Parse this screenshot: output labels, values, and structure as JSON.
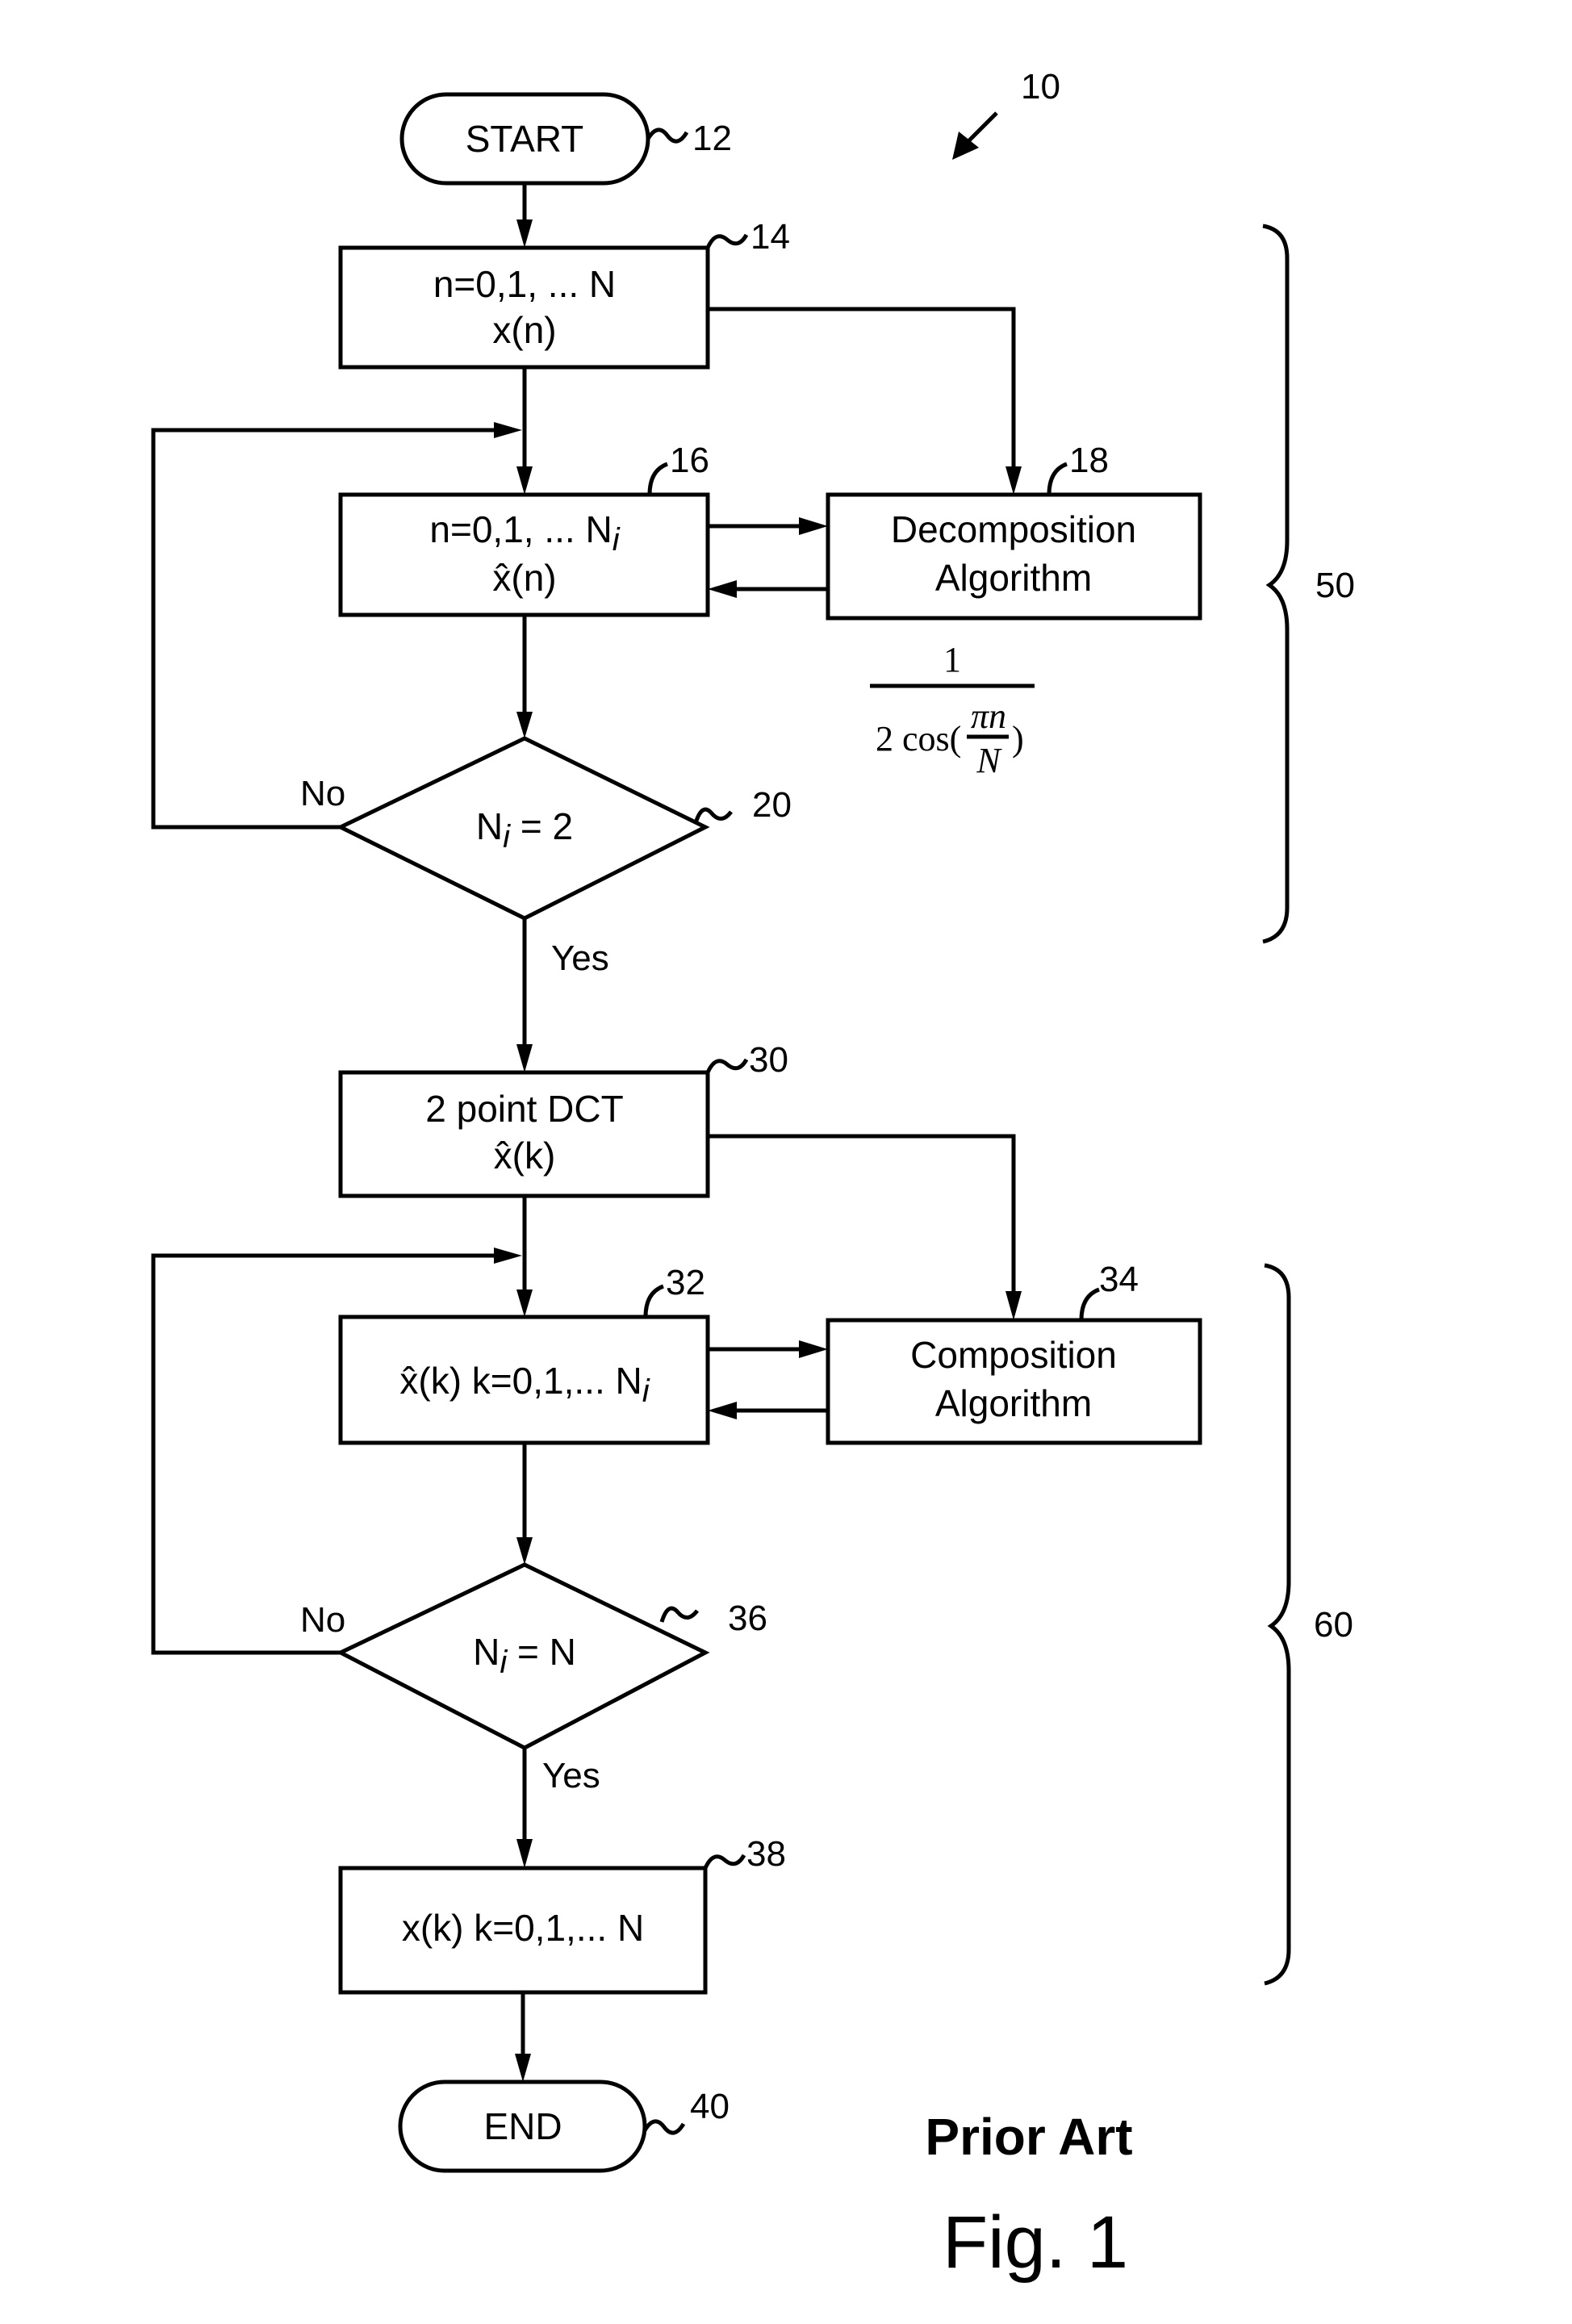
{
  "figure": {
    "ref_number": "10",
    "caption_prior": "Prior Art",
    "caption_fig": "Fig. 1"
  },
  "nodes": {
    "start": {
      "text": "START",
      "ref": "12"
    },
    "input_samples": {
      "line1": "n=0,1, ... N",
      "line2": "x(n)",
      "ref": "14"
    },
    "decomp_stage": {
      "line1": "n=0,1, ... N",
      "line1_sub": "i",
      "line2": "x̂(n)",
      "ref": "16"
    },
    "decomp_algo": {
      "line1": "Decomposition",
      "line2": "Algorithm",
      "ref": "18"
    },
    "decision_2": {
      "prefix": "N",
      "sub": "i",
      "suffix": " = 2",
      "ref": "20",
      "no": "No",
      "yes": "Yes"
    },
    "dct2": {
      "line1": "2 point DCT",
      "line2": "x̂(k)",
      "ref": "30"
    },
    "comp_stage": {
      "line1": "x̂(k)   k=0,1,... N",
      "line1_sub": "i",
      "ref": "32"
    },
    "comp_algo": {
      "line1": "Composition",
      "line2": "Algorithm",
      "ref": "34"
    },
    "decision_n": {
      "prefix": "N",
      "sub": "i",
      "suffix": " = N",
      "ref": "36",
      "no": "No",
      "yes": "Yes"
    },
    "output": {
      "text": "x(k)   k=0,1,... N",
      "ref": "38"
    },
    "end": {
      "text": "END",
      "ref": "40"
    }
  },
  "formula": {
    "numerator": "1",
    "denominator_prefix": "2 cos(",
    "frac_num": "πn",
    "frac_den": "N",
    "denominator_suffix": ")"
  },
  "braces": {
    "decomposition": {
      "ref": "50"
    },
    "composition": {
      "ref": "60"
    }
  }
}
